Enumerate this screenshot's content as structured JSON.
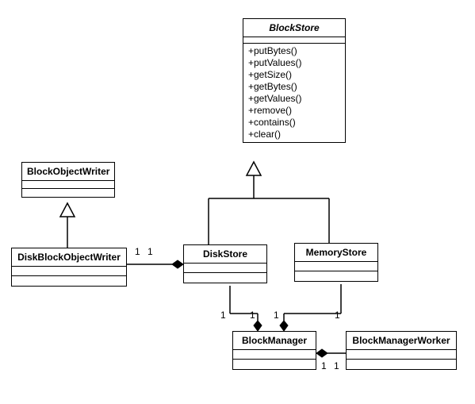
{
  "classes": {
    "blockStore": {
      "name": "BlockStore",
      "methods": [
        "+putBytes()",
        "+putValues()",
        "+getSize()",
        "+getBytes()",
        "+getValues()",
        "+remove()",
        "+contains()",
        "+clear()"
      ]
    },
    "blockObjectWriter": {
      "name": "BlockObjectWriter"
    },
    "diskBlockObjectWriter": {
      "name": "DiskBlockObjectWriter"
    },
    "diskStore": {
      "name": "DiskStore"
    },
    "memoryStore": {
      "name": "MemoryStore"
    },
    "blockManager": {
      "name": "BlockManager"
    },
    "blockManagerWorker": {
      "name": "BlockManagerWorker"
    }
  },
  "multiplicities": {
    "one": "1"
  },
  "chart_data": {
    "type": "uml_class_diagram",
    "classes": [
      {
        "name": "BlockStore",
        "abstract": true,
        "methods": [
          "+putBytes()",
          "+putValues()",
          "+getSize()",
          "+getBytes()",
          "+getValues()",
          "+remove()",
          "+contains()",
          "+clear()"
        ]
      },
      {
        "name": "BlockObjectWriter"
      },
      {
        "name": "DiskBlockObjectWriter"
      },
      {
        "name": "DiskStore"
      },
      {
        "name": "MemoryStore"
      },
      {
        "name": "BlockManager"
      },
      {
        "name": "BlockManagerWorker"
      }
    ],
    "relationships": [
      {
        "type": "generalization",
        "child": "DiskBlockObjectWriter",
        "parent": "BlockObjectWriter"
      },
      {
        "type": "generalization",
        "child": "DiskStore",
        "parent": "BlockStore"
      },
      {
        "type": "generalization",
        "child": "MemoryStore",
        "parent": "BlockStore"
      },
      {
        "type": "composition",
        "whole": "DiskStore",
        "part": "DiskBlockObjectWriter",
        "wholeMult": "1",
        "partMult": "1"
      },
      {
        "type": "composition",
        "whole": "BlockManager",
        "part": "DiskStore",
        "wholeMult": "1",
        "partMult": "1"
      },
      {
        "type": "composition",
        "whole": "BlockManager",
        "part": "MemoryStore",
        "wholeMult": "1",
        "partMult": "1"
      },
      {
        "type": "composition",
        "whole": "BlockManager",
        "part": "BlockManagerWorker",
        "wholeMult": "1",
        "partMult": "1"
      }
    ]
  }
}
